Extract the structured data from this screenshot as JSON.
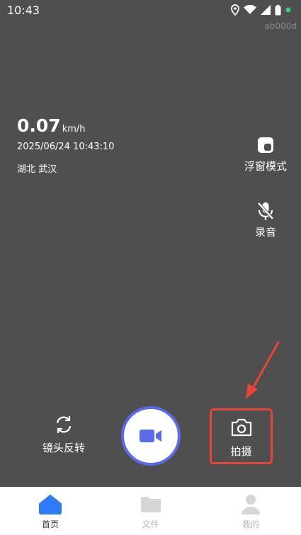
{
  "status_bar": {
    "time": "10:43"
  },
  "device_tag": "ab000d",
  "dashboard": {
    "speed_value": "0.07",
    "speed_unit": "km/h",
    "datetime": "2025/06/24 10:43:10",
    "location": "湖北 武汉"
  },
  "side_controls": {
    "float_mode_label": "浮窗模式",
    "audio_label": "录音"
  },
  "bottom_controls": {
    "flip_label": "镜头反转",
    "photo_label": "拍摄"
  },
  "tabs": [
    {
      "label": "首页",
      "active": true
    },
    {
      "label": "文件",
      "active": false
    },
    {
      "label": "我的",
      "active": false
    }
  ],
  "colors": {
    "accent": "#2f7bf5",
    "record_ring": "#5a6ae8",
    "highlight": "#e8443a",
    "background": "#4f4f4f"
  }
}
